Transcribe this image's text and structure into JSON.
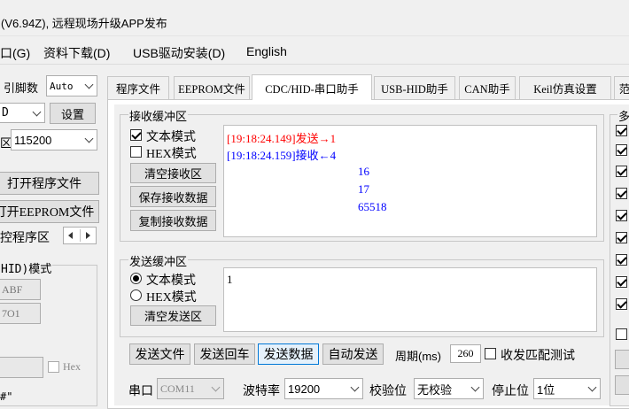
{
  "window": {
    "title": "(V6.94Z), 远程现场升级APP发布"
  },
  "menu": [
    "口(G)",
    "资料下载(D)",
    "USB驱动安装(D)",
    "English"
  ],
  "left_panel": {
    "pin_label": "引脚数",
    "pin_value": "Auto",
    "combo_d_value": "D",
    "settings_button": "设置",
    "baud_label": "区",
    "baud_value": "115200",
    "open_program_button": "打开程序文件",
    "open_eeprom_button": "打开EEPROM文件",
    "program_area_label": "控程序区",
    "hid_mode_label": "HID)模式",
    "field1_value": "ABF",
    "field2_value": "7O1",
    "hex_label": "Hex",
    "bottom_text": "#\""
  },
  "tabs": [
    "程序文件",
    "EEPROM文件",
    "CDC/HID-串口助手",
    "USB-HID助手",
    "CAN助手",
    "Keil仿真设置",
    "范"
  ],
  "receive": {
    "group_label": "接收缓冲区",
    "text_mode_label": "文本模式",
    "hex_mode_label": "HEX模式",
    "clear_button": "清空接收区",
    "save_button": "保存接收数据",
    "copy_button": "复制接收数据",
    "lines": [
      {
        "text": "[19:18:24.149]发送→1",
        "color": "#ff0000"
      },
      {
        "text": "[19:18:24.159]接收←4",
        "color": "#0000ff"
      },
      {
        "text": "16",
        "color": "#0000ff"
      },
      {
        "text": "17",
        "color": "#0000ff"
      },
      {
        "text": "65518",
        "color": "#0000ff"
      }
    ]
  },
  "send": {
    "group_label": "发送缓冲区",
    "text_mode_label": "文本模式",
    "hex_mode_label": "HEX模式",
    "clear_button": "清空发送区",
    "content": "1"
  },
  "actions": {
    "send_file": "发送文件",
    "send_enter": "发送回车",
    "send_data": "发送数据",
    "auto_send": "自动发送",
    "period_label": "周期(ms)",
    "period_value": "260",
    "match_test_label": "收发匹配测试"
  },
  "serial": {
    "port_label": "串口",
    "port_value": "COM11",
    "baud_label": "波特率",
    "baud_value": "19200",
    "parity_label": "校验位",
    "parity_value": "无校验",
    "stop_label": "停止位",
    "stop_value": "1位"
  },
  "right_panel": {
    "header": "多"
  }
}
